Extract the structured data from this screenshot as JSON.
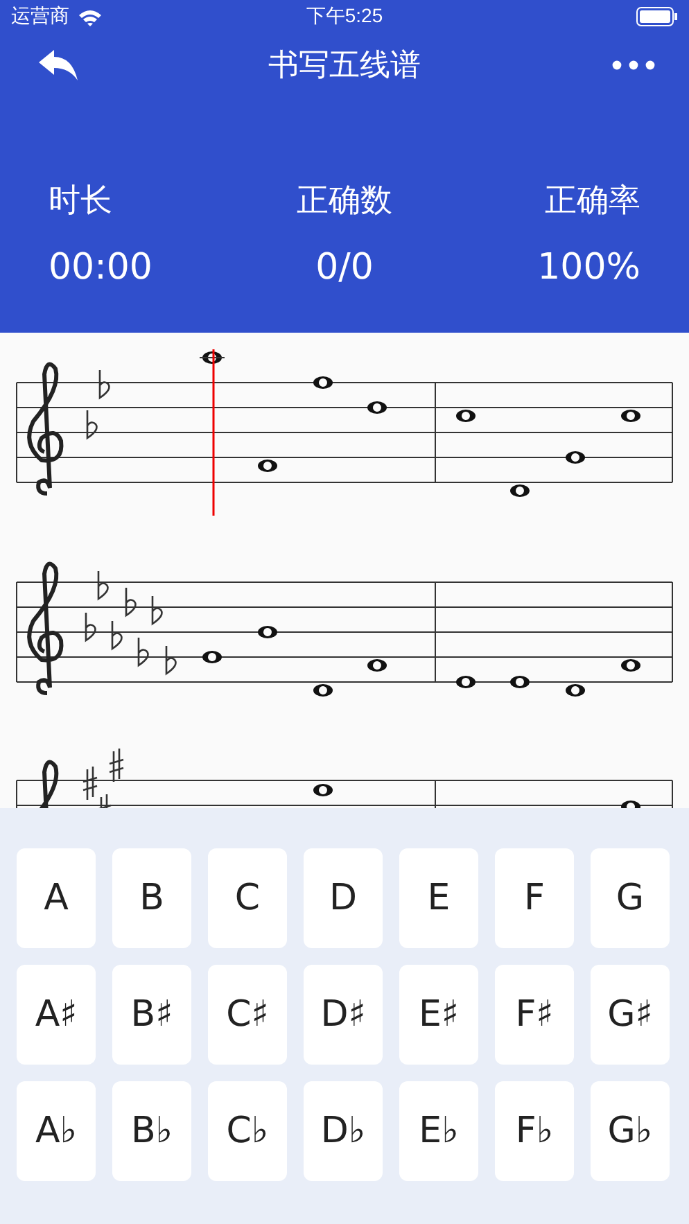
{
  "status_bar": {
    "carrier": "运营商",
    "time": "下午5:25"
  },
  "nav": {
    "title": "书写五线谱"
  },
  "stats": [
    {
      "label": "时长",
      "value": "00:00"
    },
    {
      "label": "正确数",
      "value": "0/0"
    },
    {
      "label": "正确率",
      "value": "100%"
    }
  ],
  "keys": [
    [
      "A",
      "B",
      "C",
      "D",
      "E",
      "F",
      "G"
    ],
    [
      "A♯",
      "B♯",
      "C♯",
      "D♯",
      "E♯",
      "F♯",
      "G♯"
    ],
    [
      "A♭",
      "B♭",
      "C♭",
      "D♭",
      "E♭",
      "F♭",
      "G♭"
    ]
  ]
}
